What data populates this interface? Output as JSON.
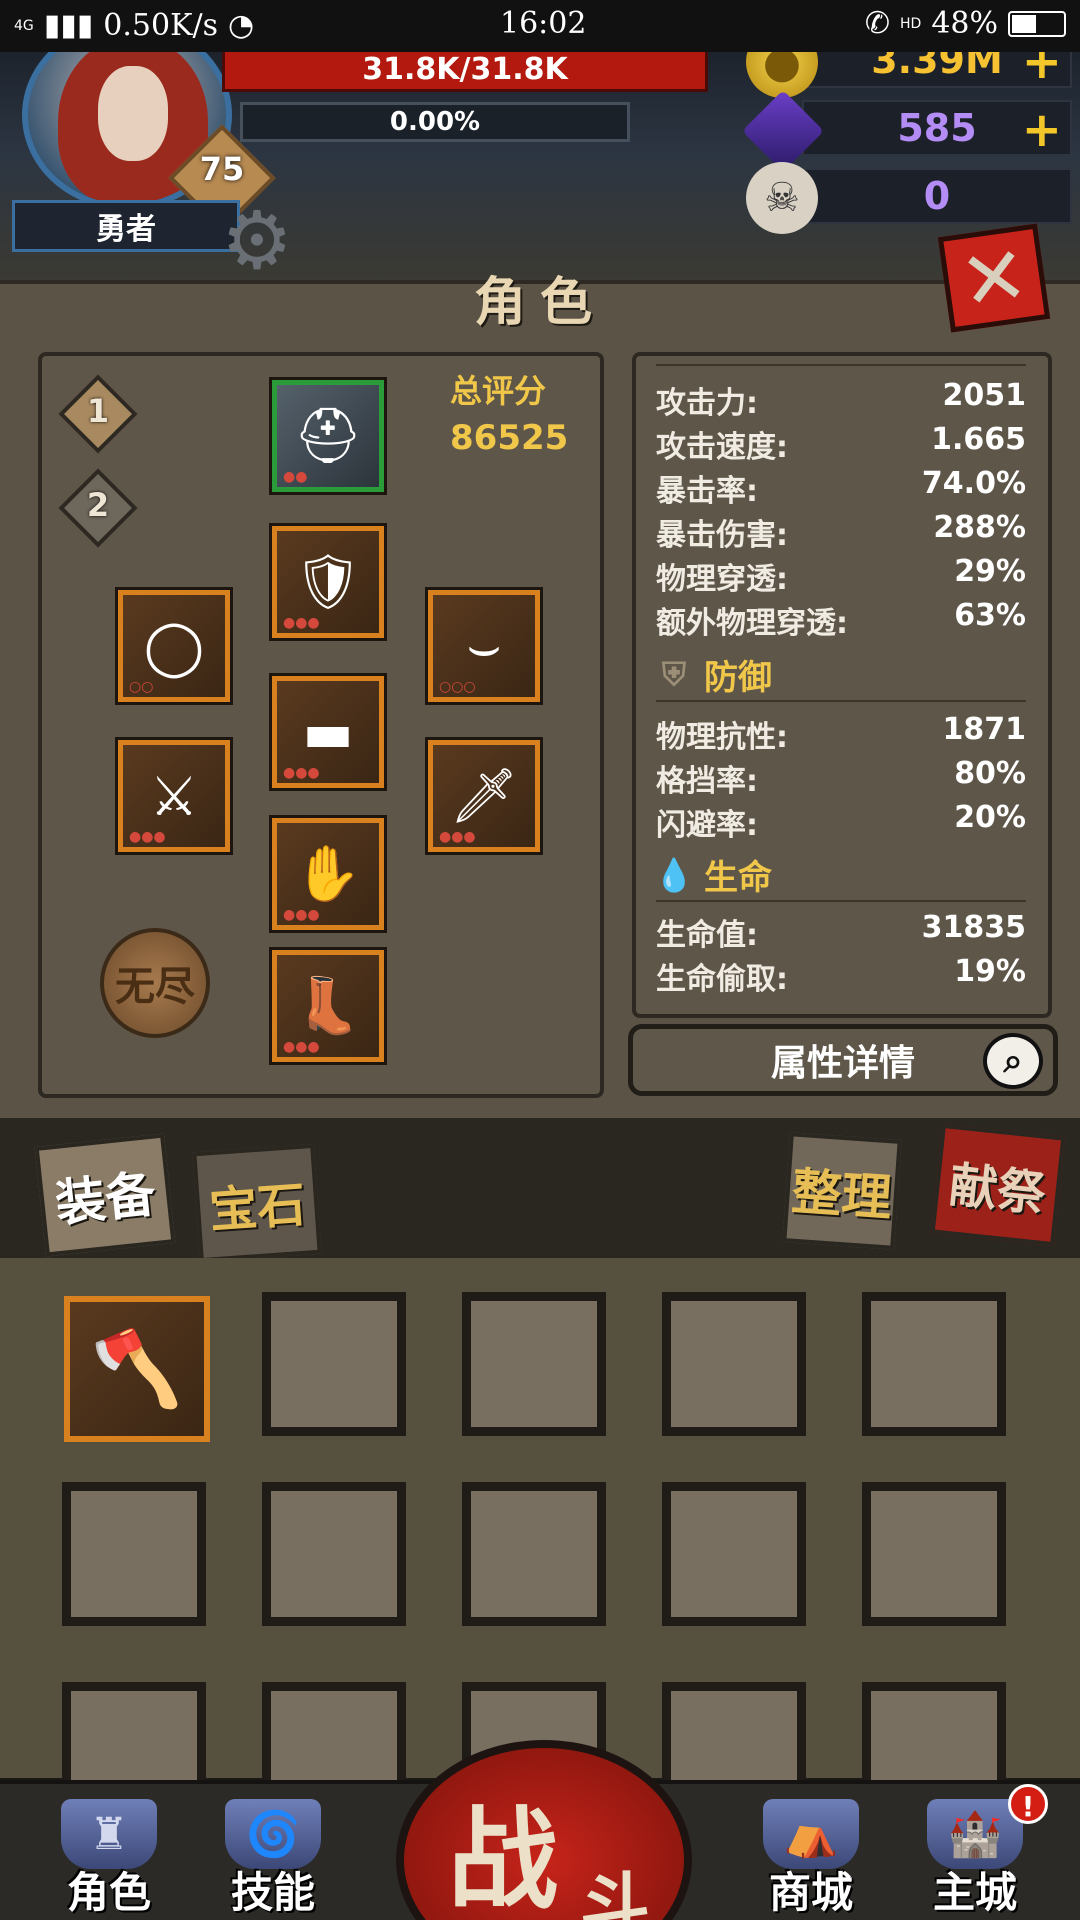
{
  "status_bar": {
    "network": "4G",
    "speed": "0.50K/s",
    "time": "16:02",
    "hd": "HD",
    "battery": "48%",
    "battery_level": 0.48
  },
  "player": {
    "name": "勇者",
    "level": "75",
    "hp": "31.8K/31.8K",
    "xp": "0.00%"
  },
  "currencies": {
    "gold": "3.39M",
    "gems": "585",
    "skulls": "0",
    "plus": "+"
  },
  "panel": {
    "title": "角色",
    "score_label": "总评分",
    "score_value": "86525"
  },
  "set_tabs": [
    "1",
    "2"
  ],
  "stats": {
    "offense": [
      {
        "k": "攻击力:",
        "v": "2051"
      },
      {
        "k": "攻击速度:",
        "v": "1.665"
      },
      {
        "k": "暴击率:",
        "v": "74.0%"
      },
      {
        "k": "暴击伤害:",
        "v": "288%"
      },
      {
        "k": "物理穿透:",
        "v": "29%"
      },
      {
        "k": "额外物理穿透:",
        "v": "63%"
      }
    ],
    "defense_title": "防御",
    "defense": [
      {
        "k": "物理抗性:",
        "v": "1871"
      },
      {
        "k": "格挡率:",
        "v": "80%"
      },
      {
        "k": "闪避率:",
        "v": "20%"
      }
    ],
    "life_title": "生命",
    "life": [
      {
        "k": "生命值:",
        "v": "31835"
      },
      {
        "k": "生命偷取:",
        "v": "19%"
      }
    ]
  },
  "detail_button": "属性详情",
  "tabs": {
    "equip": "装备",
    "gem": "宝石",
    "sort": "整理",
    "sacrifice": "献祭"
  },
  "nav": {
    "character": "角色",
    "skills": "技能",
    "battle_main": "战",
    "battle_sub": "斗",
    "shop": "商城",
    "city": "主城",
    "alert": "!"
  },
  "seal_text": "无尽",
  "icons": {
    "gear": "gear-icon",
    "close": "close-icon",
    "search": "search-icon",
    "gold": "gold-coin-icon",
    "gem": "crystal-icon",
    "skull": "ram-skull-icon",
    "shield": "shield-icon",
    "drop": "blood-drop-icon"
  },
  "colors": {
    "accent_gold": "#f1c74a",
    "hp_red": "#b3190f",
    "item_border": "#d9801f",
    "set_border": "#2a9c3a"
  }
}
